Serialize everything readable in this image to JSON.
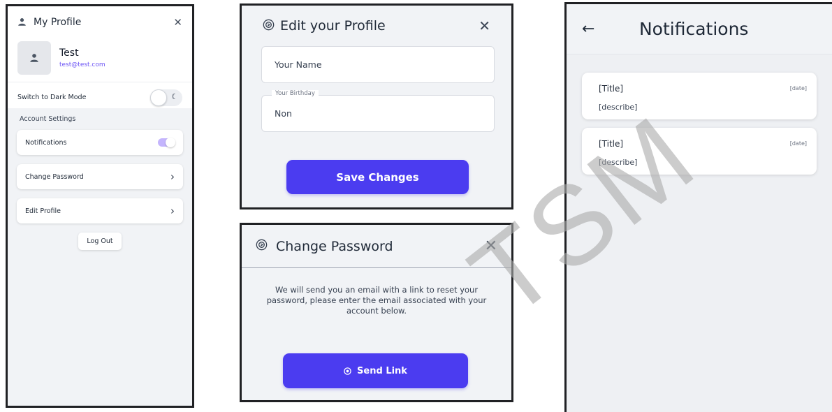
{
  "profile_panel": {
    "title": "My Profile",
    "user": {
      "name": "Test",
      "email": "test@test.com"
    },
    "dark_mode": {
      "label": "Switch to Dark Mode",
      "enabled": false
    },
    "account_settings_label": "Account Settings",
    "settings": [
      {
        "label": "Notifications",
        "control": "toggle",
        "enabled": true
      },
      {
        "label": "Change Password",
        "control": "chevron"
      },
      {
        "label": "Edit Profile",
        "control": "chevron"
      }
    ],
    "logout_label": "Log Out",
    "icons": {
      "header": "person-icon",
      "avatar": "person-icon",
      "close": "close-icon",
      "moon": "moon-icon"
    }
  },
  "edit_profile_panel": {
    "title": "Edit your Profile",
    "name_field": {
      "placeholder": "Your Name",
      "value": ""
    },
    "birthday_field": {
      "legend": "Your Birthday",
      "value": "Non"
    },
    "save_label": "Save Changes",
    "icons": {
      "header": "edit-profile-icon",
      "close": "close-icon"
    }
  },
  "change_password_panel": {
    "title": "Change Password",
    "message": "We will send you an email with a link to reset your password, please enter the email associated with your account below.",
    "send_label": "Send Link",
    "icons": {
      "header": "change-password-icon",
      "close": "close-icon",
      "send": "link-icon"
    }
  },
  "notifications_panel": {
    "title": "Notifications",
    "items": [
      {
        "title": "[Title]",
        "description": "[describe]",
        "date": "[date]"
      },
      {
        "title": "[Title]",
        "description": "[describe]",
        "date": "[date]"
      }
    ],
    "icons": {
      "back": "back-arrow-icon"
    }
  },
  "watermark_text": "TSM",
  "colors": {
    "accent": "#4b3cf0",
    "toggle_on": "#c4b5fd",
    "email_link": "#6d55f5",
    "panel_background": "#f1f3f6",
    "panel_border": "#202124"
  }
}
